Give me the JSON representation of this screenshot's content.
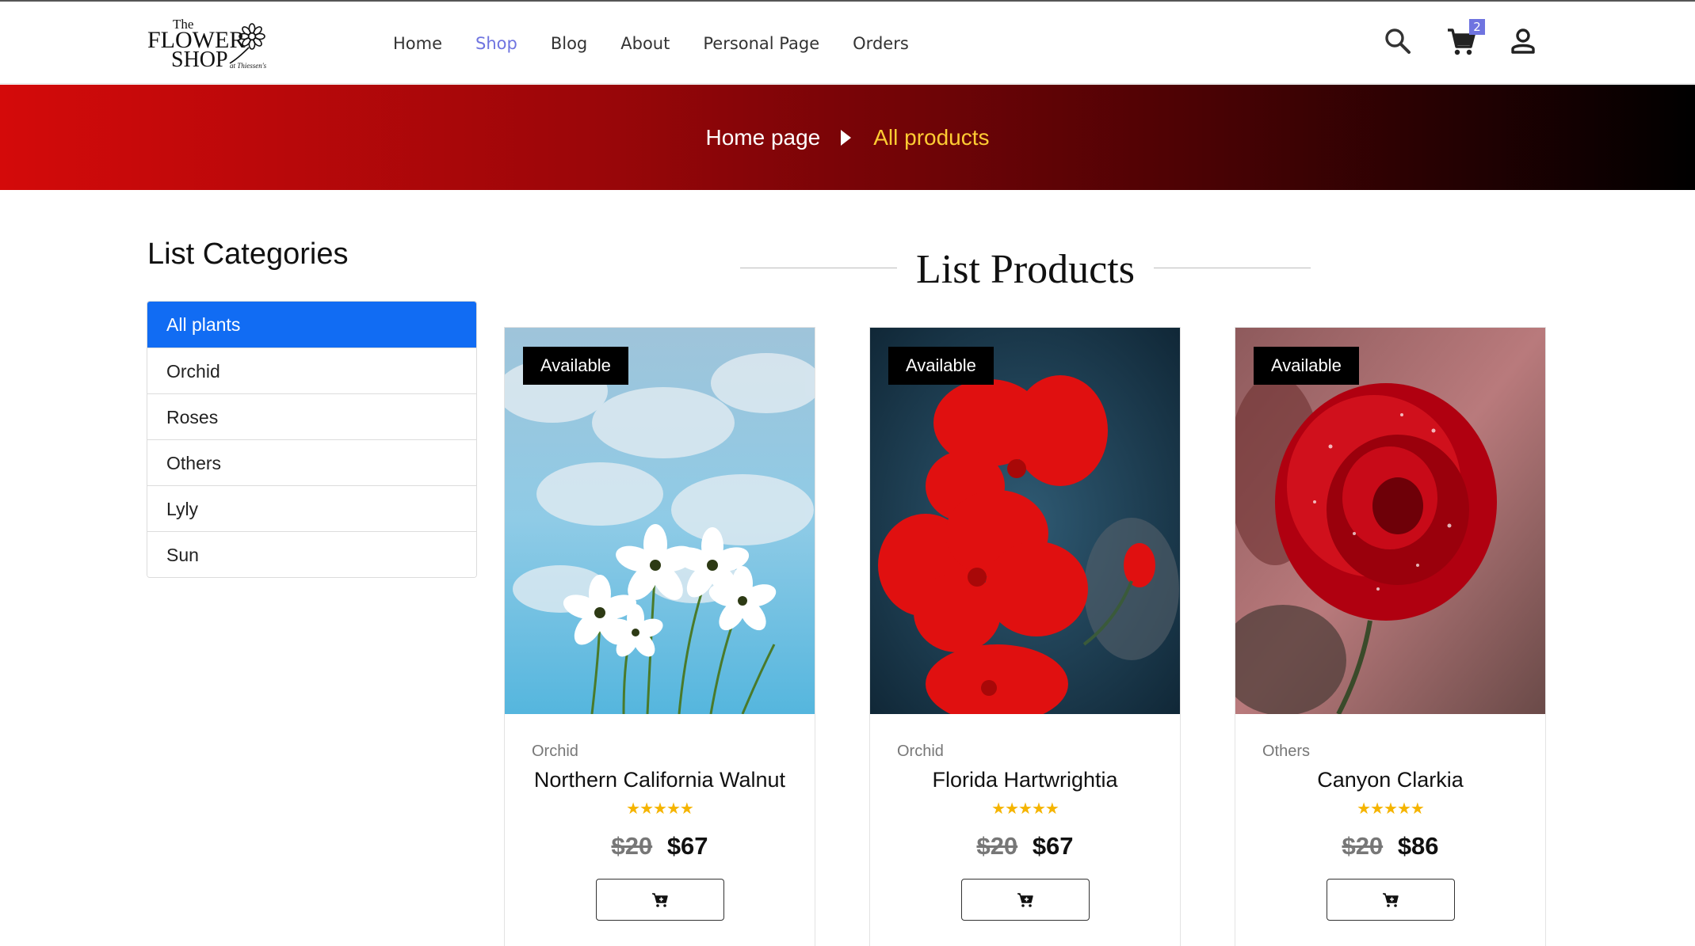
{
  "header": {
    "logo": {
      "line1": "The",
      "line2": "FLOWER",
      "line3": "SHOP",
      "script": "at Thiessen's"
    },
    "nav": [
      {
        "label": "Home",
        "active": false
      },
      {
        "label": "Shop",
        "active": true
      },
      {
        "label": "Blog",
        "active": false
      },
      {
        "label": "About",
        "active": false
      },
      {
        "label": "Personal Page",
        "active": false
      },
      {
        "label": "Orders",
        "active": false
      }
    ],
    "icons": [
      "search-icon",
      "cart-icon",
      "user-icon"
    ],
    "cart_count": "2",
    "accent_color": "#6f74e0"
  },
  "banner": {
    "home": "Home page",
    "current": "All products",
    "gradient": [
      "#d40a0a",
      "#000000"
    ]
  },
  "sidebar": {
    "title": "List Categories",
    "items": [
      {
        "label": "All plants",
        "active": true
      },
      {
        "label": "Orchid",
        "active": false
      },
      {
        "label": "Roses",
        "active": false
      },
      {
        "label": "Others",
        "active": false
      },
      {
        "label": "Lyly",
        "active": false
      },
      {
        "label": "Sun",
        "active": false
      }
    ],
    "active_color": "#116cf3"
  },
  "products": {
    "title": "List Products",
    "items": [
      {
        "badge": "Available",
        "category": "Orchid",
        "name": "Northern California Walnut",
        "stars": "★★★★★",
        "old_price": "$20",
        "price": "$67"
      },
      {
        "badge": "Available",
        "category": "Orchid",
        "name": "Florida Hartwrightia",
        "stars": "★★★★★",
        "old_price": "$20",
        "price": "$67"
      },
      {
        "badge": "Available",
        "category": "Others",
        "name": "Canyon Clarkia",
        "stars": "★★★★★",
        "old_price": "$20",
        "price": "$86"
      }
    ],
    "star_color": "#f5b400"
  }
}
